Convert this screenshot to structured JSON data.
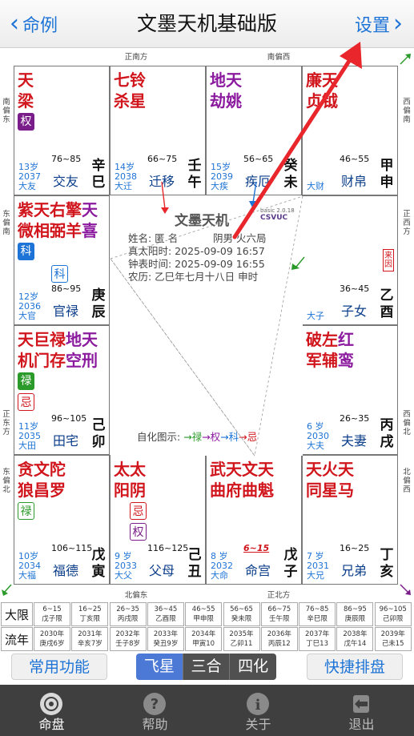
{
  "navbar": {
    "back_label": "命例",
    "title": "文墨天机基础版",
    "settings_label": "设置"
  },
  "directions": {
    "top_left": "正南方",
    "top_right": "南偏西",
    "bottom_left": "北偏东",
    "bottom_right": "正北方",
    "left": [
      "南偏东",
      "东偏南",
      "正东方",
      "东偏北"
    ],
    "right": [
      "西偏南",
      "正西方",
      "西偏北",
      "北偏西"
    ]
  },
  "palaces": [
    {
      "stars": [
        {
          "text": "天梁",
          "color": "red"
        }
      ],
      "hua": [
        {
          "text": "权",
          "type": "quan"
        }
      ],
      "age": "13岁",
      "year": "2037",
      "da": "大友",
      "range": "76~85",
      "name": "交友",
      "gz": "辛巳"
    },
    {
      "stars": [
        {
          "text": "七杀",
          "color": "red"
        },
        {
          "text": "铃星",
          "color": "red"
        }
      ],
      "hua": [],
      "age": "14岁",
      "year": "2038",
      "da": "大迁",
      "range": "66~75",
      "name": "迁移",
      "gz": "壬午"
    },
    {
      "stars": [
        {
          "text": "地劫",
          "color": "pur"
        },
        {
          "text": "天姚",
          "color": "pur"
        }
      ],
      "hua": [],
      "age": "15岁",
      "year": "2039",
      "da": "大疾",
      "range": "56~65",
      "name": "疾厄",
      "gz": "癸未"
    },
    {
      "stars": [
        {
          "text": "廉贞",
          "color": "red"
        },
        {
          "text": "天钺",
          "color": "red"
        }
      ],
      "hua": [],
      "age": "",
      "year": "",
      "da": "大财",
      "range": "46~55",
      "name": "财帛",
      "gz": "甲申"
    },
    {
      "stars": [
        {
          "text": "紫微",
          "color": "red"
        },
        {
          "text": "天相",
          "color": "red"
        },
        {
          "text": "右弼",
          "color": "red"
        },
        {
          "text": "擎羊",
          "color": "red"
        },
        {
          "text": "天喜",
          "color": "pur"
        }
      ],
      "hua": [
        {
          "text": "科",
          "type": "ke"
        },
        {
          "text": "科",
          "type": "ke-o"
        }
      ],
      "age": "12岁",
      "year": "2036",
      "da": "大官",
      "range": "86~95",
      "name": "官禄",
      "gz": "庚辰"
    },
    {
      "stars": [],
      "hua": [],
      "age": "",
      "year": "",
      "da": "大子",
      "range": "36~45",
      "name": "子女",
      "gz": "乙酉",
      "laiyin": "来因"
    },
    {
      "stars": [
        {
          "text": "天机",
          "color": "red"
        },
        {
          "text": "巨门",
          "color": "red"
        },
        {
          "text": "禄存",
          "color": "red"
        },
        {
          "text": "地空",
          "color": "pur"
        },
        {
          "text": "天刑",
          "color": "pur"
        }
      ],
      "hua": [
        {
          "text": "禄",
          "type": "lu"
        },
        {
          "text": "忌",
          "type": "ji"
        }
      ],
      "age": "11岁",
      "year": "2035",
      "da": "大田",
      "range": "96~105",
      "name": "田宅",
      "gz": "己卯"
    },
    {
      "stars": [
        {
          "text": "破军",
          "color": "red"
        },
        {
          "text": "左辅",
          "color": "red"
        },
        {
          "text": "红鸾",
          "color": "pur"
        }
      ],
      "hua": [],
      "age": "6 岁",
      "year": "2030",
      "da": "大夫",
      "range": "26~35",
      "name": "夫妻",
      "gz": "丙戌"
    },
    {
      "stars": [
        {
          "text": "贪狼",
          "color": "red"
        },
        {
          "text": "文昌",
          "color": "red"
        },
        {
          "text": "陀罗",
          "color": "red"
        }
      ],
      "hua": [
        {
          "text": "禄",
          "type": "lu-o"
        }
      ],
      "age": "10岁",
      "year": "2034",
      "da": "大福",
      "range": "106~115",
      "name": "福德",
      "gz": "戊寅"
    },
    {
      "stars": [
        {
          "text": "太阳",
          "color": "red"
        },
        {
          "text": "太阴",
          "color": "red"
        }
      ],
      "hua": [
        {
          "text": "忌",
          "type": "ji"
        },
        {
          "text": "权",
          "type": "quan-o"
        }
      ],
      "age": "9 岁",
      "year": "2033",
      "da": "大父",
      "range": "116~125",
      "name": "父母",
      "gz": "己丑"
    },
    {
      "stars": [
        {
          "text": "武曲",
          "color": "red"
        },
        {
          "text": "天府",
          "color": "red"
        },
        {
          "text": "文曲",
          "color": "red"
        },
        {
          "text": "天魁",
          "color": "red"
        }
      ],
      "hua": [],
      "age": "8 岁",
      "year": "2032",
      "da": "大命",
      "range": "6~15",
      "name": "命宫",
      "gz": "戊子"
    },
    {
      "stars": [
        {
          "text": "天同",
          "color": "red"
        },
        {
          "text": "火星",
          "color": "red"
        },
        {
          "text": "天马",
          "color": "red"
        }
      ],
      "hua": [],
      "age": "7 岁",
      "year": "2031",
      "da": "大兄",
      "range": "16~25",
      "name": "兄弟",
      "gz": "丁亥"
    }
  ],
  "center": {
    "title": "文墨天机",
    "version": "basic 2.0.18",
    "brand": "CSVUC",
    "name_line": "姓名: 匿 名",
    "gender_line": "阴男 火六局",
    "solar_line": "真太阳时: 2025-09-09 16:57",
    "clock_line": "钟表时间: 2025-09-09 16:55",
    "lunar_line": "农历: 乙巳年七月十八日 申时",
    "legend_label": "自化图示: ",
    "legend_items": [
      "→禄",
      "→权",
      "→科",
      "→忌"
    ]
  },
  "table": {
    "daxian_label": "大限",
    "liunian_label": "流年",
    "daxian": [
      [
        "6~15",
        "戊子限"
      ],
      [
        "16~25",
        "丁亥限"
      ],
      [
        "26~35",
        "丙戌限"
      ],
      [
        "36~45",
        "乙酉限"
      ],
      [
        "46~55",
        "甲申限"
      ],
      [
        "56~65",
        "癸未限"
      ],
      [
        "66~75",
        "壬午限"
      ],
      [
        "76~85",
        "辛巳限"
      ],
      [
        "86~95",
        "庚辰限"
      ],
      [
        "96~105",
        "己卯限"
      ]
    ],
    "liunian": [
      [
        "2030年",
        "庚戌6岁"
      ],
      [
        "2031年",
        "辛亥7岁"
      ],
      [
        "2032年",
        "壬子8岁"
      ],
      [
        "2033年",
        "癸丑9岁"
      ],
      [
        "2034年",
        "甲寅10"
      ],
      [
        "2035年",
        "乙卯11"
      ],
      [
        "2036年",
        "丙辰12"
      ],
      [
        "2037年",
        "丁巳13"
      ],
      [
        "2038年",
        "戊午14"
      ],
      [
        "2039年",
        "己未15"
      ]
    ]
  },
  "toolbar": {
    "common_label": "常用功能",
    "seg": [
      "飞星",
      "三合",
      "四化"
    ],
    "seg_active": 0,
    "quick_label": "快捷排盘"
  },
  "tabbar": [
    {
      "label": "命盘",
      "icon": "disc-icon"
    },
    {
      "label": "帮助",
      "icon": "help-icon"
    },
    {
      "label": "关于",
      "icon": "info-icon"
    },
    {
      "label": "退出",
      "icon": "exit-icon"
    }
  ],
  "colors": {
    "accent": "#1e74d6",
    "red": "#d0151c",
    "purple": "#8b1a9e",
    "annotation": "#e8262b"
  }
}
